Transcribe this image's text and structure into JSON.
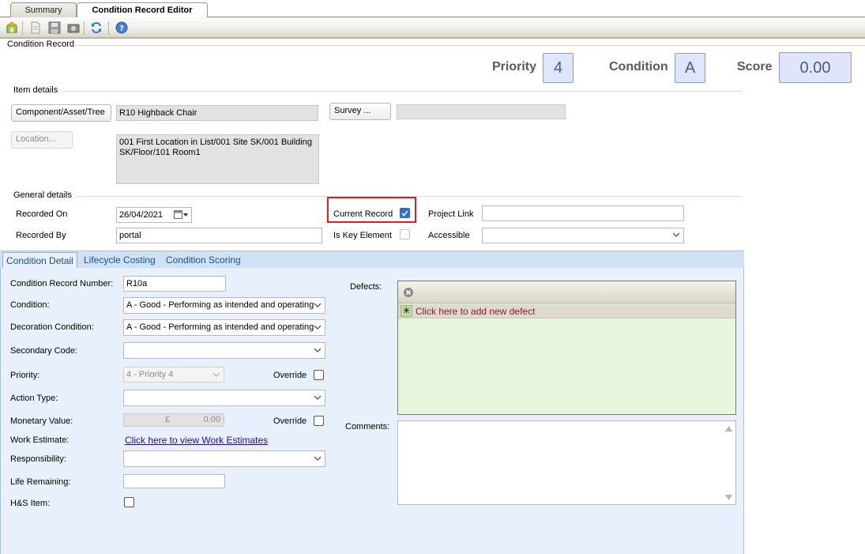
{
  "tabs": [
    {
      "label": "Summary",
      "active": false
    },
    {
      "label": "Condition Record Editor",
      "active": true
    }
  ],
  "toolbar_icons": [
    "new-record-icon",
    "document-icon",
    "save-icon",
    "camera-icon",
    "refresh-icon",
    "help-icon"
  ],
  "header": {
    "section_title": "Condition Record",
    "priority_label": "Priority",
    "priority_value": "4",
    "condition_label": "Condition",
    "condition_value": "A",
    "score_label": "Score",
    "score_value": "0.00"
  },
  "item_details": {
    "title": "Item details",
    "component_button": "Component/Asset/Tree",
    "component_value": "R10 Highback Chair",
    "survey_button": "Survey ...",
    "survey_value": "",
    "location_button": "Location...",
    "location_value": "001 First Location in List/001 Site SK/001 Building SK/Floor/101 Room1"
  },
  "general_details": {
    "title": "General details",
    "recorded_on_label": "Recorded On",
    "recorded_on_value": "26/04/2021",
    "recorded_by_label": "Recorded By",
    "recorded_by_value": "portal",
    "current_record_label": "Current Record",
    "current_record_checked": true,
    "is_key_element_label": "Is Key Element",
    "is_key_element_checked": false,
    "project_link_label": "Project Link",
    "project_link_value": "",
    "accessible_label": "Accessible",
    "accessible_value": ""
  },
  "sub_tabs": [
    {
      "label": "Condition Detail",
      "active": true
    },
    {
      "label": "Lifecycle Costing",
      "active": false
    },
    {
      "label": "Condition Scoring",
      "active": false
    }
  ],
  "condition_detail": {
    "record_number_label": "Condition Record Number:",
    "record_number_value": "R10a",
    "condition_label": "Condition:",
    "condition_value": "A - Good - Performing as intended and operating",
    "decoration_label": "Decoration Condition:",
    "decoration_value": "A - Good - Performing as intended and operating",
    "secondary_code_label": "Secondary Code:",
    "secondary_code_value": "",
    "priority_label": "Priority:",
    "priority_value": "4 - Priority 4",
    "override_label": "Override",
    "action_type_label": "Action Type:",
    "action_type_value": "",
    "monetary_label": "Monetary Value:",
    "monetary_currency": "£",
    "monetary_value": "0.00",
    "override2_label": "Override",
    "work_estimate_label": "Work Estimate:",
    "work_estimate_link": "Click here to view Work Estimates",
    "responsibility_label": "Responsibility:",
    "responsibility_value": "",
    "life_remaining_label": "Life Remaining:",
    "life_remaining_value": "",
    "hs_item_label": "H&S Item:",
    "defects_label": "Defects:",
    "add_defect_text": "Click here to add new defect",
    "comments_label": "Comments:",
    "comments_value": ""
  },
  "colors": {
    "highlight_box": "#e02020",
    "panel_background": "#e8f1fb",
    "defects_background": "#eaf5dd",
    "add_defect_text": "#8b1a1a"
  }
}
